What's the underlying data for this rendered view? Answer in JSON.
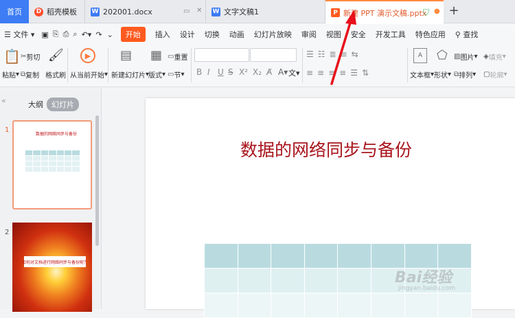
{
  "tabs": {
    "home": "首页",
    "t1": "稻壳模板",
    "t2": "202001.docx",
    "t3": "文字文稿1",
    "t4": "新建 PPT 演示文稿.pptx"
  },
  "menu": {
    "file": "文件",
    "items": [
      "开始",
      "插入",
      "设计",
      "切换",
      "动画",
      "幻灯片放映",
      "审阅",
      "视图",
      "安全",
      "开发工具",
      "特色应用"
    ],
    "search": "查找"
  },
  "ribbon": {
    "paste": "粘贴",
    "cut": "剪切",
    "copy": "复制",
    "format_painter": "格式刷",
    "from_current": "从当前开始",
    "new_slide": "新建幻灯片",
    "layout": "版式",
    "reset": "重置",
    "section": "节",
    "textbox": "文本框",
    "shape": "形状",
    "picture": "图片",
    "fill": "填充",
    "arrange": "排列",
    "outline": "轮廓",
    "font_color_glyph": "文"
  },
  "panel": {
    "outline_tab": "大纲",
    "slides_tab": "幻灯片",
    "slide1_num": "1",
    "slide2_num": "2",
    "slide1_title": "数据的网络同步与备份",
    "slide2_text": "如何对文档进行网络同步与备份呢？"
  },
  "slide": {
    "title": "数据的网络同步与备份"
  },
  "watermark": {
    "brand": "Bai经验",
    "url": "jingyan.baidu.com"
  },
  "colors": {
    "accent": "#ff5a1f",
    "home_tab": "#3d7cf4",
    "title_red": "#a8141c"
  }
}
